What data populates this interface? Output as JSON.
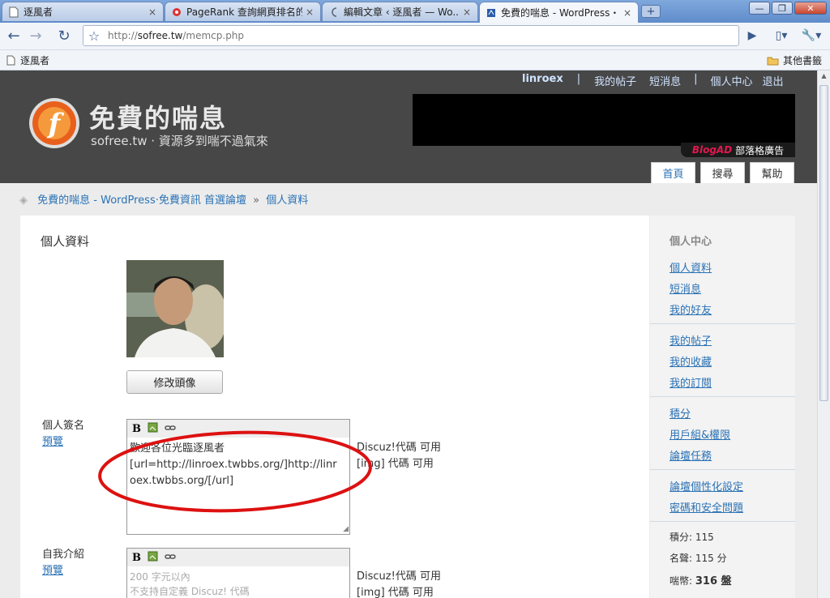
{
  "browser": {
    "tabs": [
      {
        "title": "逐風者",
        "close": "×"
      },
      {
        "title": "PageRank 查詢網頁排名的...",
        "close": "×"
      },
      {
        "title": "編輯文章 ‹ 逐風者 — Wo...",
        "close": "×"
      },
      {
        "title": "免費的喘息 - WordPress・...",
        "close": "×"
      }
    ],
    "new_tab": "+",
    "window_buttons": [
      "—",
      "❐",
      "✕"
    ],
    "url_scheme": "http://",
    "url_host": "sofree.tw",
    "url_path": "/memcp.php",
    "bookmarks": {
      "left": "逐風者",
      "right": "其他書籤"
    }
  },
  "site": {
    "logo_title": "免費的喘息",
    "logo_subtitle": "sofree.tw · 資源多到喘不過氣來",
    "topnav": {
      "user": "linroex",
      "sep": "|",
      "my_posts": "我的帖子",
      "messages": "短消息",
      "user_center": "個人中心",
      "logout": "退出"
    },
    "ad_label_brand": "BlogAD",
    "ad_label_text": "部落格廣告",
    "nav_tabs": [
      "首頁",
      "搜尋",
      "幫助"
    ],
    "breadcrumb": {
      "home": "免費的喘息 - WordPress·免費資訊 首選論壇",
      "sep": "»",
      "current": "個人資料"
    }
  },
  "profile": {
    "heading": "個人資料",
    "change_avatar": "修改頭像",
    "signature_label": "個人簽名",
    "preview": "預覽",
    "signature_lines": [
      "歡迎各位光臨逐風者",
      "[url=http://linroex.twbbs.org/]http://linr",
      "oex.twbbs.org/[/url]"
    ],
    "hint_discuz": "Discuz!代碼 可用",
    "hint_img": "[img] 代碼 可用",
    "intro_label": "自我介紹",
    "intro_preview": "預覽",
    "intro_placeholder_lines": [
      "200 字元以內",
      "不支持自定義 Discuz! 代碼"
    ],
    "toolbar": {
      "bold": "B"
    }
  },
  "sidebar": {
    "title": "個人中心",
    "group1": [
      "個人資料",
      "短消息",
      "我的好友"
    ],
    "group2": [
      "我的帖子",
      "我的收藏",
      "我的訂閱"
    ],
    "group3": [
      "積分",
      "用戶組&權限",
      "論壇任務"
    ],
    "group4": [
      "論壇個性化設定",
      "密碼和安全問題"
    ],
    "stats": [
      {
        "label": "積分:",
        "value": "115"
      },
      {
        "label": "名聲:",
        "value": "115 分"
      },
      {
        "label": "喘幣:",
        "value": "316 盤"
      }
    ]
  }
}
